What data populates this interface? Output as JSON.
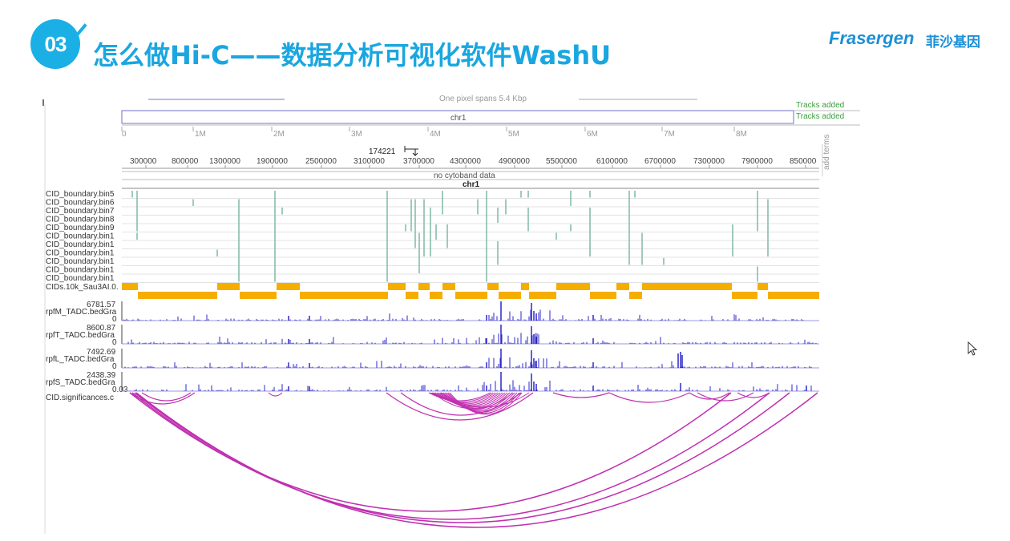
{
  "header": {
    "badge": "03",
    "title": "怎么做Hi-C——数据分析可视化软件WashU",
    "logo": "Frasergen",
    "logo_cn": "菲沙基因"
  },
  "browser": {
    "top_ruler_text": "One pixel spans 5.4 Kbp",
    "tracks_added_1": "Tracks added",
    "tracks_added_2": "Tracks added",
    "chrom_box_label": "chr1",
    "add_terms": "add terms",
    "chrom_mb_ticks": [
      "0",
      "1M",
      "2M",
      "3M",
      "4M",
      "5M",
      "6M",
      "7M",
      "8M"
    ],
    "position_label": "174221",
    "coord_ticks": [
      "300000",
      "800000",
      "1300000",
      "1900000",
      "2500000",
      "3100000",
      "3700000",
      "4300000",
      "4900000",
      "5500000",
      "6100000",
      "6700000",
      "7300000",
      "7900000",
      "850000"
    ],
    "cytoband_text": "no cytoband data",
    "chrom_label": "chr1",
    "boundary_tracks": [
      "CID_boundary.bin5",
      "CID_boundary.bin6",
      "CID_boundary.bin7",
      "CID_boundary.bin8",
      "CID_boundary.bin9",
      "CID_boundary.bin1",
      "CID_boundary.bin1",
      "CID_boundary.bin1",
      "CID_boundary.bin1",
      "CID_boundary.bin1",
      "CID_boundary.bin1"
    ],
    "cids_track": "CIDs.10k_Sau3AI.0.",
    "signal_tracks": [
      {
        "name": "rpfM_TADC.bedGra",
        "max": "6781.57",
        "min": "0"
      },
      {
        "name": "rpfT_TADC.bedGra",
        "max": "8600.87",
        "min": "0"
      },
      {
        "name": "rpfL_TADC.bedGra",
        "max": "7492.69",
        "min": "0"
      },
      {
        "name": "rpfS_TADC.bedGra",
        "max": "2438.39",
        "min": "0.03"
      }
    ],
    "significance_track": "CID.significances.c",
    "colors": {
      "accent": "#1ab0e6",
      "boundary": "#7fb8a6",
      "cid_domain": "#f5ad00",
      "signal": "#2d27c8",
      "arc": "#c030b0",
      "tracks_added": "#3aa13a"
    }
  }
}
